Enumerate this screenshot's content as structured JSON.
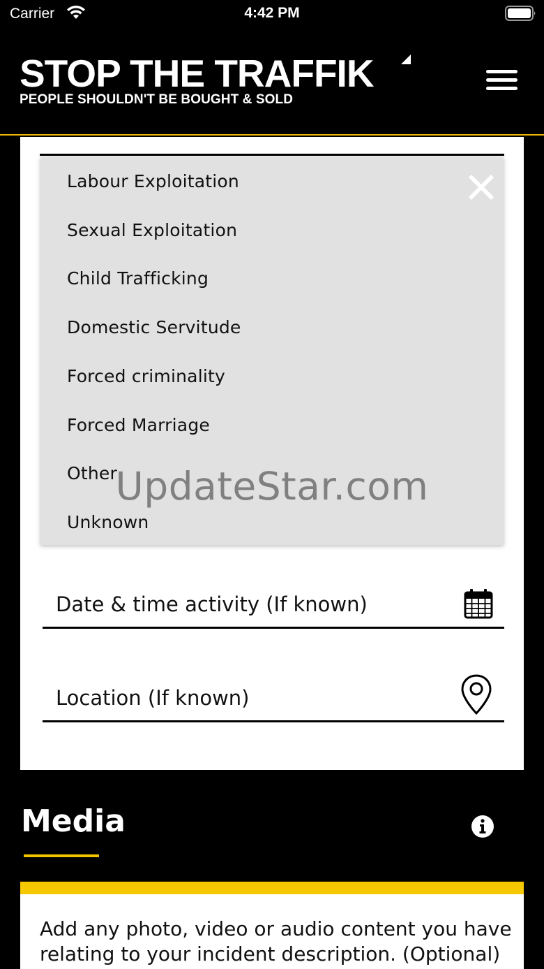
{
  "status_bar": {
    "carrier": "Carrier",
    "time": "4:42 PM"
  },
  "header": {
    "logo_title": "STOP THE TRAFFIK",
    "logo_tagline": "PEOPLE SHOULDN'T BE BOUGHT & SOLD",
    "icons": [
      "menu-icon"
    ]
  },
  "dropdown": {
    "items": [
      "Labour Exploitation",
      "Sexual Exploitation",
      "Child Trafficking",
      "Domestic Servitude",
      "Forced criminality",
      "Forced Marriage",
      "Other",
      "Unknown"
    ],
    "close_icon": "close-icon"
  },
  "watermark": "UpdateStar.com",
  "fields": {
    "date_label": "Date & time activity (If known)",
    "location_label": "Location (If known)"
  },
  "media": {
    "title": "Media",
    "description": "Add any photo, video or audio content you have relating to your incident description. (Optional)"
  },
  "colors": {
    "background": "#000000",
    "accent_yellow": "#f6c800",
    "dropdown_bg": "#e1e1e1",
    "card_bg": "#ffffff"
  }
}
